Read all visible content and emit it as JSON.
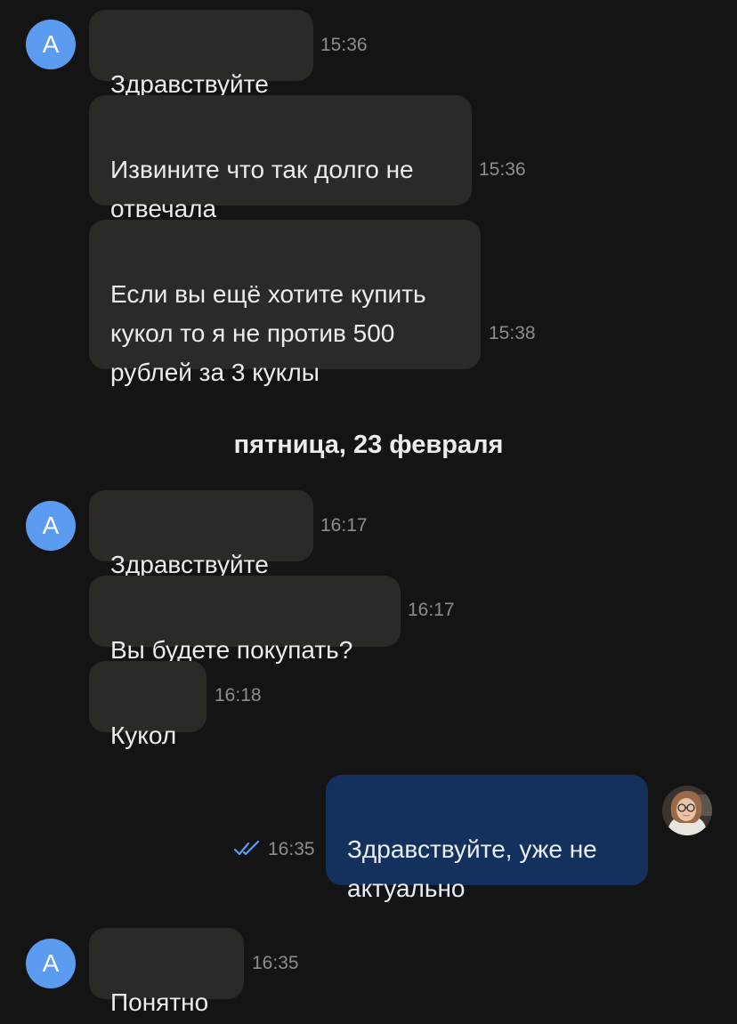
{
  "colors": {
    "background": "#141414",
    "incoming_bubble": "#2b2a27",
    "outgoing_bubble": "#13315c",
    "avatar": "#5b9bf0",
    "read_ticks": "#5b9bf0",
    "timestamp": "#8d8d8d"
  },
  "contact": {
    "avatar_letter": "A"
  },
  "messages": [
    {
      "text": "Здравствуйте",
      "time": "15:36"
    },
    {
      "text": "Извините что так долго не\nотвечала",
      "time": "15:36"
    },
    {
      "text": "Если  вы ещё хотите купить\nкукол  то я не против 500\nрублей за 3 куклы",
      "time": "15:38"
    },
    {
      "text": "Здравствуйте",
      "time": "16:17"
    },
    {
      "text": "Вы будете покупать?",
      "time": "16:17"
    },
    {
      "text": "Кукол",
      "time": "16:18"
    },
    {
      "text": "Здравствуйте, уже не\nактуально",
      "time": "16:35",
      "status_icon": "double-check-icon"
    },
    {
      "text": "Понятно",
      "time": "16:35"
    }
  ],
  "date_separator": "пятница, 23 февраля",
  "self_avatar_icon": "user-photo-avatar"
}
